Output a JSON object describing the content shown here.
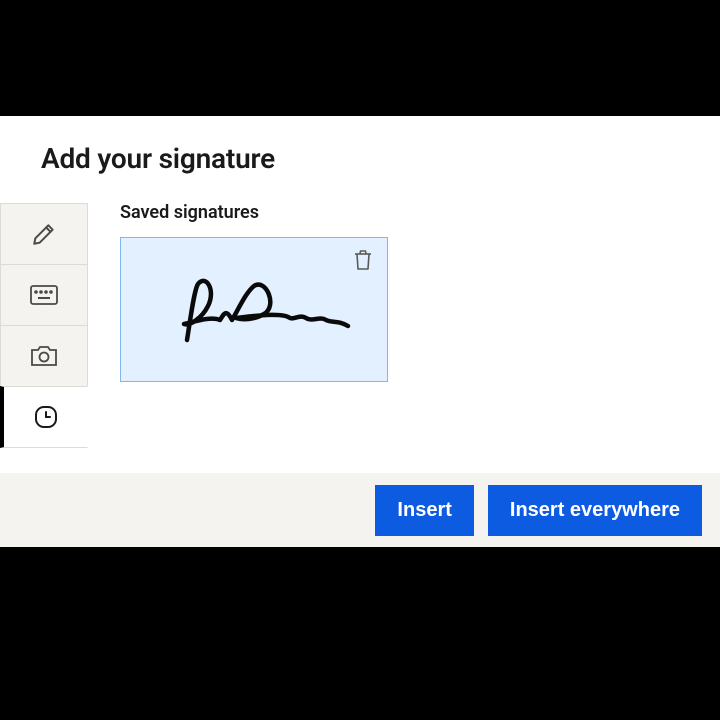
{
  "dialog": {
    "title": "Add your signature",
    "section_label": "Saved signatures",
    "tabs": {
      "draw": "Draw",
      "type": "Type",
      "camera": "Camera",
      "recent": "Recent"
    }
  },
  "actions": {
    "insert": "Insert",
    "insert_everywhere": "Insert everywhere"
  },
  "icons": {
    "pencil": "pencil-icon",
    "keyboard": "keyboard-icon",
    "camera": "camera-icon",
    "clock": "clock-icon",
    "trash": "trash-icon"
  },
  "colors": {
    "primary": "#0d5be1",
    "selected_bg": "#e3f0ff",
    "selected_border": "#82b6ef",
    "panel_bg": "#f4f3f0"
  }
}
